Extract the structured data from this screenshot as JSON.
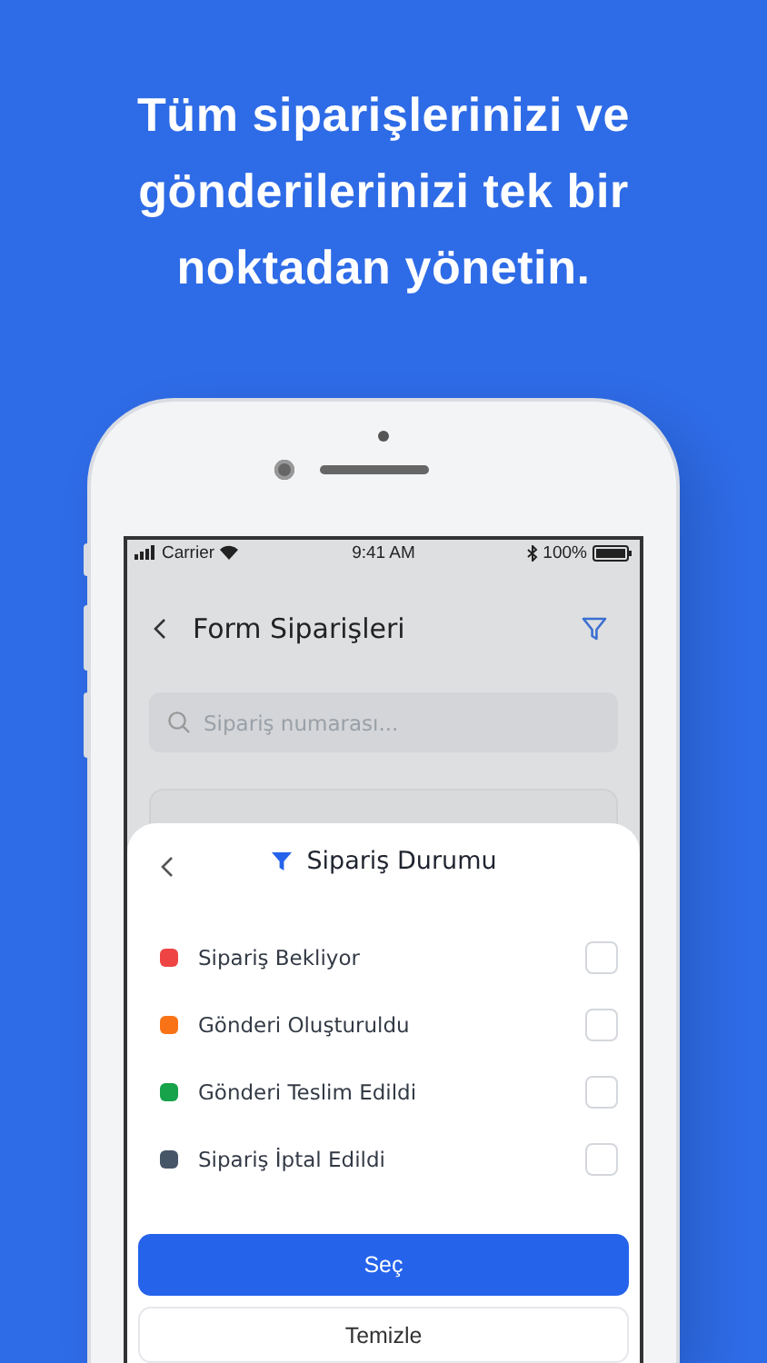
{
  "headline": "Tüm siparişlerinizi ve gönderilerinizi tek bir noktadan yönetin.",
  "status_bar": {
    "carrier": "Carrier",
    "time": "9:41 AM",
    "battery": "100%"
  },
  "nav": {
    "title": "Form Siparişleri"
  },
  "search": {
    "placeholder": "Sipariş numarası..."
  },
  "sheet": {
    "title": "Sipariş Durumu",
    "options": [
      {
        "label": "Sipariş Bekliyor",
        "color": "#ef4444",
        "checked": false
      },
      {
        "label": "Gönderi Oluşturuldu",
        "color": "#f97316",
        "checked": false
      },
      {
        "label": "Gönderi Teslim Edildi",
        "color": "#16a34a",
        "checked": false
      },
      {
        "label": "Sipariş İptal Edildi",
        "color": "#475569",
        "checked": false
      }
    ],
    "buttons": [
      {
        "label": "Seç",
        "kind": "primary"
      },
      {
        "label": "Temizle",
        "kind": "secondary"
      }
    ]
  }
}
